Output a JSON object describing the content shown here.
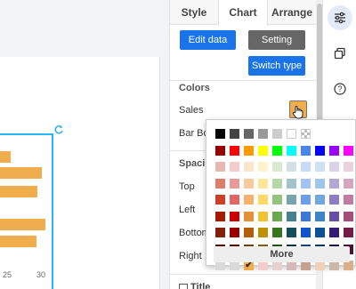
{
  "tabs": [
    {
      "label": "Style",
      "active": false
    },
    {
      "label": "Chart",
      "active": true
    },
    {
      "label": "Arrange",
      "active": false
    }
  ],
  "buttons": {
    "edit_data": "Edit data",
    "setting": "Setting",
    "switch_type": "Switch type"
  },
  "colors_section": {
    "title": "Colors",
    "sales_label": "Sales",
    "sales_color": "#f0ad4e",
    "bar_border_label": "Bar Bord"
  },
  "spacing_section": {
    "title": "Spacing",
    "top_label": "Top",
    "left_label": "Left",
    "bottom_label": "Bottom",
    "right_label": "Right"
  },
  "title_checkbox": {
    "label": "Title",
    "checked": false
  },
  "palette": {
    "more_label": "More",
    "selected_row": 6,
    "selected_col": 2,
    "rows": [
      [
        "#000000",
        "#434343",
        "#666666",
        "#999999",
        "#cccccc",
        "#ffffff",
        "transparent"
      ],
      [
        "#980000",
        "#ff0000",
        "#ff9900",
        "#ffff00",
        "#00ff00",
        "#00ffff",
        "#4a86e8",
        "#0000ff",
        "#9900ff",
        "#ff00ff"
      ],
      [
        "#e6b8af",
        "#f4cccc",
        "#fce5cd",
        "#fff2cc",
        "#d9ead3",
        "#d0e0e3",
        "#c9daf8",
        "#cfe2f3",
        "#d9d2e9",
        "#ead1dc"
      ],
      [
        "#dd7e6b",
        "#ea9999",
        "#f9cb9c",
        "#ffe599",
        "#b6d7a8",
        "#a2c4c9",
        "#a4c2f4",
        "#9fc5e8",
        "#b4a7d6",
        "#d5a6bd"
      ],
      [
        "#cc4125",
        "#e06666",
        "#f6b26b",
        "#ffd966",
        "#93c47d",
        "#76a5af",
        "#6d9eeb",
        "#6fa8dc",
        "#8e7cc3",
        "#c27ba0"
      ],
      [
        "#a61c00",
        "#cc0000",
        "#e69138",
        "#f1c232",
        "#6aa84f",
        "#45818e",
        "#3c78d8",
        "#3d85c6",
        "#674ea7",
        "#a64d79"
      ],
      [
        "#85200c",
        "#990000",
        "#b45f06",
        "#bf9000",
        "#38761d",
        "#134f5c",
        "#1155cc",
        "#0b5394",
        "#351c75",
        "#741b47"
      ],
      [
        "#5b0f00",
        "#660000",
        "#783f04",
        "#7f6000",
        "#274e13",
        "#0c343d",
        "#1c4587",
        "#073763",
        "#20124d",
        "#4c1130"
      ],
      [
        "#d9d9d9",
        "#d9d9d9",
        "#f0ad4e",
        "#f4cccc",
        "#e6d0d0",
        "#d5b8b8",
        "#c7a08f",
        "#f0d0b8",
        "#cbb8a8",
        "#d9b08c"
      ]
    ]
  },
  "chart_data": {
    "type": "bar",
    "orientation": "horizontal",
    "series": [
      {
        "name": "Sales",
        "values": [
          8,
          31,
          28,
          34,
          27
        ]
      }
    ],
    "x_ticks": [
      "25",
      "30"
    ],
    "color": "#f0ad4e"
  },
  "icons": [
    "sliders-icon",
    "copy-icon",
    "help-icon",
    "rotate-icon",
    "hand-cursor-icon",
    "checkmark-icon"
  ]
}
